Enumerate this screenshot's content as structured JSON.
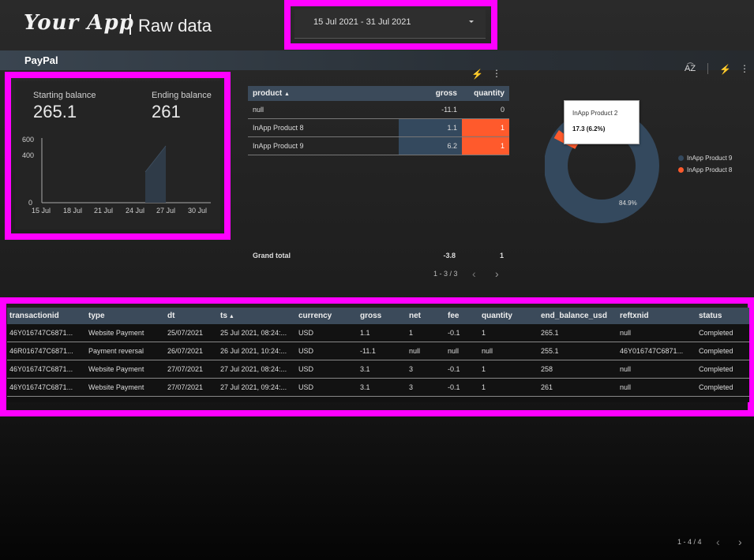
{
  "header": {
    "logo": "Your App",
    "title": "Raw data",
    "date_range": "15 Jul 2021 - 31 Jul 2021"
  },
  "section": {
    "title": "PayPal"
  },
  "balance_card": {
    "start_label": "Starting balance",
    "start_value": "265.1",
    "end_label": "Ending balance",
    "end_value": "261",
    "y_ticks": [
      "600",
      "400",
      "0"
    ],
    "x_ticks": [
      "15 Jul",
      "18 Jul",
      "21 Jul",
      "24 Jul",
      "27 Jul",
      "30 Jul"
    ]
  },
  "product_table": {
    "headers": {
      "product": "product",
      "gross": "gross",
      "quantity": "quantity"
    },
    "rows": [
      {
        "product": "null",
        "gross": "-11.1",
        "quantity": "0"
      },
      {
        "product": "InApp Product 8",
        "gross": "1.1",
        "quantity": "1"
      },
      {
        "product": "InApp Product 9",
        "gross": "6.2",
        "quantity": "1"
      }
    ],
    "grand_total_label": "Grand total",
    "grand_total_gross": "-3.8",
    "grand_total_quantity": "1",
    "pager": "1 - 3 / 3"
  },
  "donut": {
    "tooltip_title": "InApp Product 2",
    "tooltip_value": "17.3 (6.2%)",
    "slice_label": "84.9%",
    "legend": [
      {
        "name": "InApp Product 9",
        "color": "#34495e"
      },
      {
        "name": "InApp Product 8",
        "color": "#ff5a2c"
      }
    ]
  },
  "transactions": {
    "headers": [
      "transactionid",
      "type",
      "dt",
      "ts",
      "currency",
      "gross",
      "net",
      "fee",
      "quantity",
      "end_balance_usd",
      "reftxnid",
      "status"
    ],
    "rows": [
      [
        "46Y016747C6871...",
        "Website Payment",
        "25/07/2021",
        "25 Jul 2021, 08:24:...",
        "USD",
        "1.1",
        "1",
        "-0.1",
        "1",
        "265.1",
        "null",
        "Completed"
      ],
      [
        "46R016747C6871...",
        "Payment reversal",
        "26/07/2021",
        "26 Jul 2021, 10:24:...",
        "USD",
        "-11.1",
        "null",
        "null",
        "null",
        "255.1",
        "46Y016747C6871...",
        "Completed"
      ],
      [
        "46Y016747C6871...",
        "Website Payment",
        "27/07/2021",
        "27 Jul 2021, 08:24:...",
        "USD",
        "3.1",
        "3",
        "-0.1",
        "1",
        "258",
        "null",
        "Completed"
      ],
      [
        "46Y016747C6871...",
        "Website Payment",
        "27/07/2021",
        "27 Jul 2021, 09:24:...",
        "USD",
        "3.1",
        "3",
        "-0.1",
        "1",
        "261",
        "null",
        "Completed"
      ]
    ],
    "pager": "1 - 4 / 4"
  },
  "colors": {
    "highlight": "#ff00ff",
    "accent": "#ff5a2c",
    "header_bg": "#3b4a5a"
  }
}
